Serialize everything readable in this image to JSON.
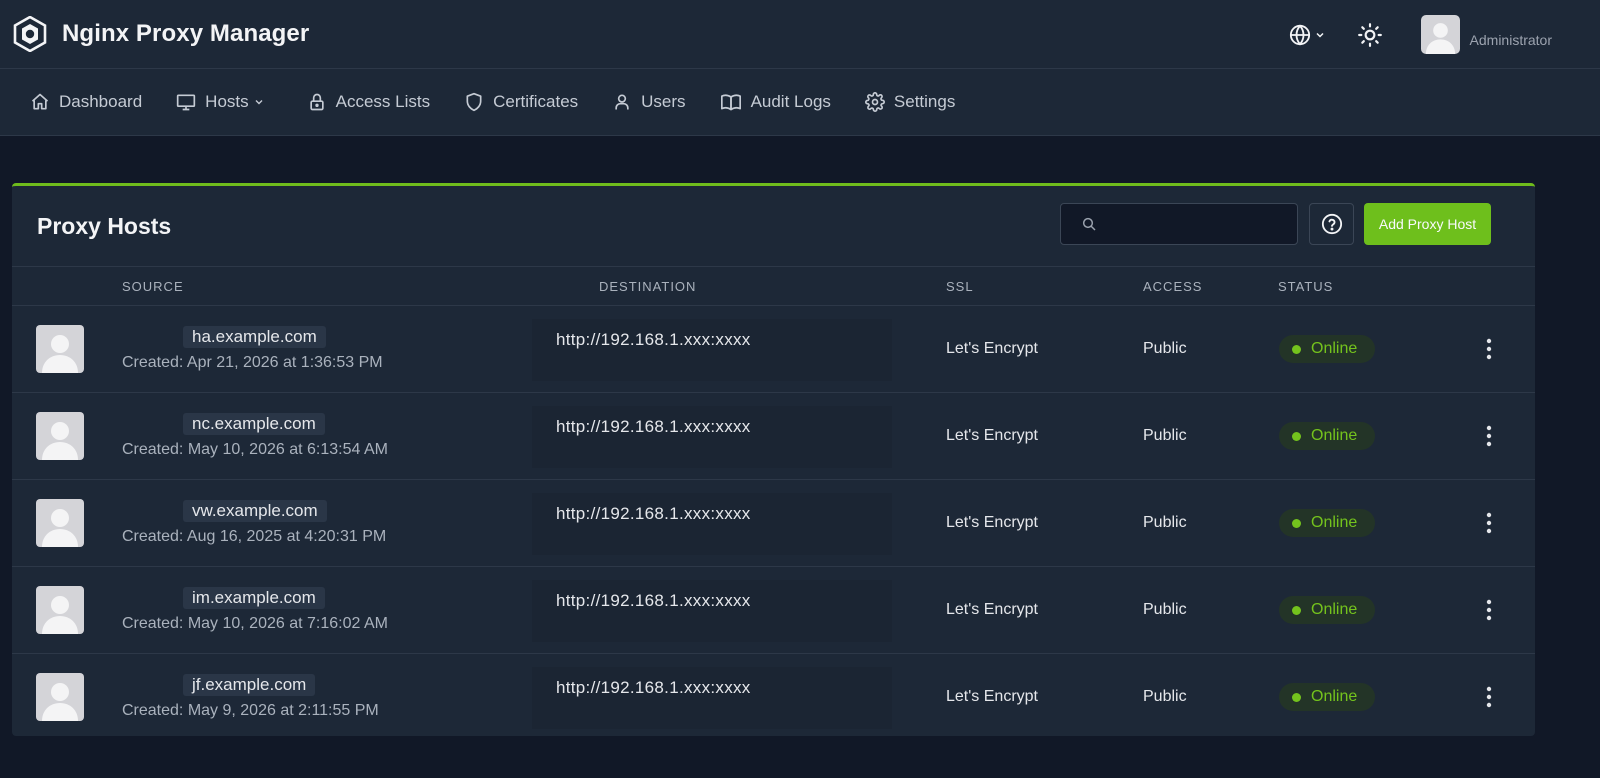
{
  "app": {
    "title": "Nginx Proxy Manager"
  },
  "header": {
    "user_name": "Administrator"
  },
  "nav": [
    {
      "label": "Dashboard",
      "icon": "home-icon"
    },
    {
      "label": "Hosts",
      "icon": "monitor-icon",
      "has_dropdown": true
    },
    {
      "label": "Access Lists",
      "icon": "lock-icon"
    },
    {
      "label": "Certificates",
      "icon": "shield-icon"
    },
    {
      "label": "Users",
      "icon": "user-icon"
    },
    {
      "label": "Audit Logs",
      "icon": "book-icon"
    },
    {
      "label": "Settings",
      "icon": "gear-icon"
    }
  ],
  "page": {
    "title": "Proxy Hosts",
    "search_placeholder": "",
    "add_button": "Add Proxy Host"
  },
  "table": {
    "columns": [
      "SOURCE",
      "DESTINATION",
      "SSL",
      "ACCESS",
      "STATUS"
    ],
    "rows": [
      {
        "domain": "ha.example.com",
        "created": "Created: Apr 21, 2026 at 1:36:53 PM",
        "destination": "http://192.168.1.xxx:xxxx",
        "ssl": "Let's Encrypt",
        "access": "Public",
        "status": "Online"
      },
      {
        "domain": "nc.example.com",
        "created": "Created: May 10, 2026 at 6:13:54 AM",
        "destination": "http://192.168.1.xxx:xxxx",
        "ssl": "Let's Encrypt",
        "access": "Public",
        "status": "Online"
      },
      {
        "domain": "vw.example.com",
        "created": "Created: Aug 16, 2025 at 4:20:31 PM",
        "destination": "http://192.168.1.xxx:xxxx",
        "ssl": "Let's Encrypt",
        "access": "Public",
        "status": "Online"
      },
      {
        "domain": "im.example.com",
        "created": "Created: May 10, 2026 at 7:16:02 AM",
        "destination": "http://192.168.1.xxx:xxxx",
        "ssl": "Let's Encrypt",
        "access": "Public",
        "status": "Online"
      },
      {
        "domain": "jf.example.com",
        "created": "Created: May 9, 2026 at 2:11:55 PM",
        "destination": "http://192.168.1.xxx:xxxx",
        "ssl": "Let's Encrypt",
        "access": "Public",
        "status": "Online"
      }
    ]
  },
  "colors": {
    "background": "#111827",
    "surface": "#1d2837",
    "accent": "#6ebf1c",
    "status_online": "#74c31d"
  }
}
